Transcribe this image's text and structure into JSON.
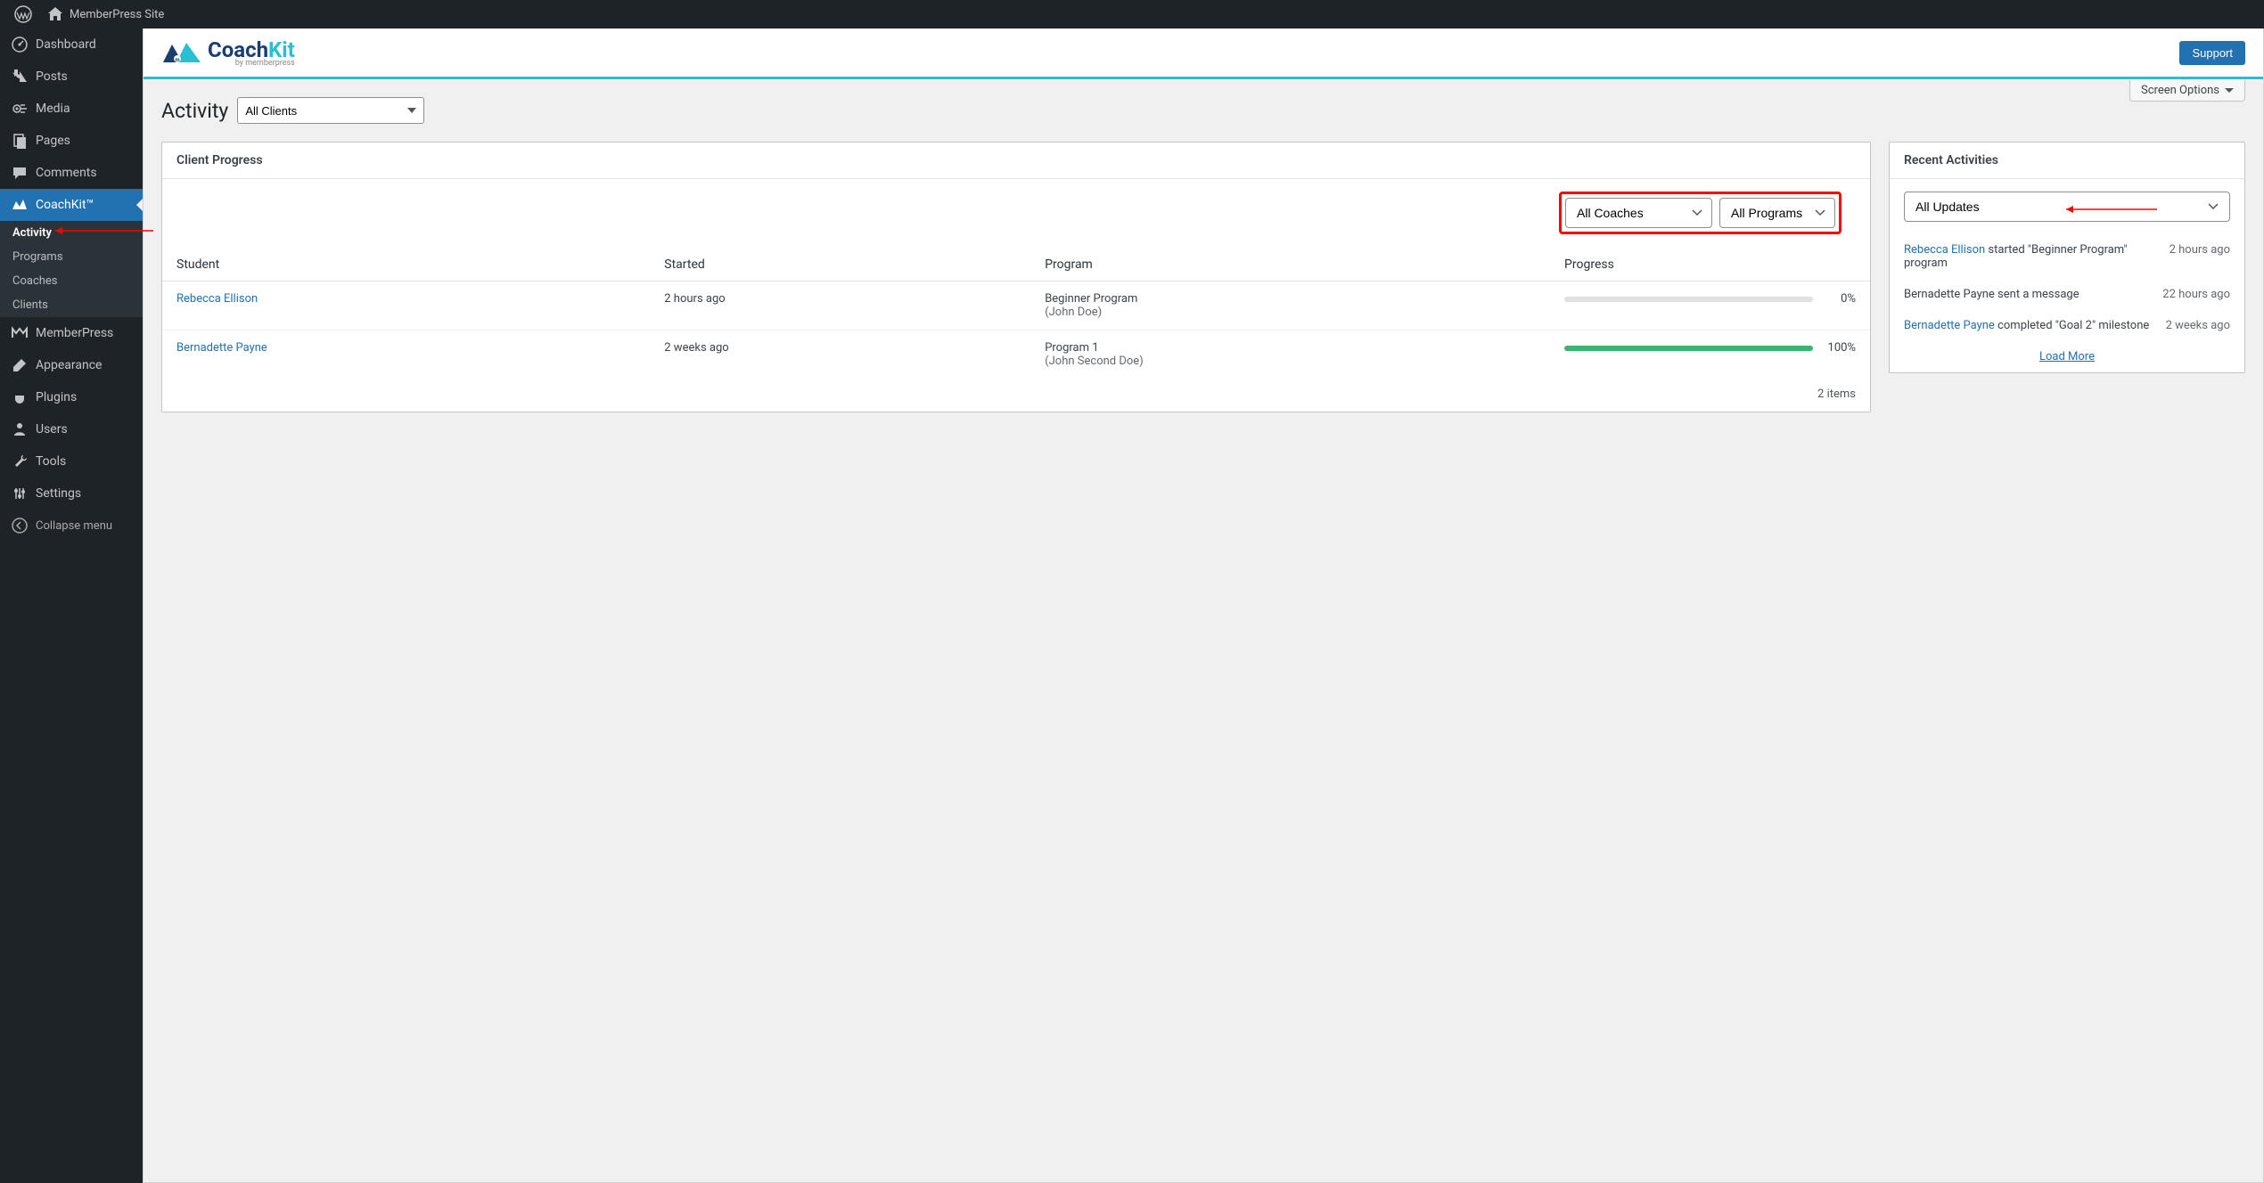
{
  "adminBar": {
    "siteName": "MemberPress Site"
  },
  "sidebar": {
    "items": [
      {
        "label": "Dashboard",
        "icon": "dashboard"
      },
      {
        "label": "Posts",
        "icon": "pin"
      },
      {
        "label": "Media",
        "icon": "media"
      },
      {
        "label": "Pages",
        "icon": "pages"
      },
      {
        "label": "Comments",
        "icon": "comments"
      },
      {
        "label": "CoachKit™",
        "icon": "coachkit",
        "active": true
      },
      {
        "label": "MemberPress",
        "icon": "memberpress"
      },
      {
        "label": "Appearance",
        "icon": "brush"
      },
      {
        "label": "Plugins",
        "icon": "plugin"
      },
      {
        "label": "Users",
        "icon": "user"
      },
      {
        "label": "Tools",
        "icon": "wrench"
      },
      {
        "label": "Settings",
        "icon": "settings"
      }
    ],
    "submenu": [
      {
        "label": "Activity",
        "current": true
      },
      {
        "label": "Programs"
      },
      {
        "label": "Coaches"
      },
      {
        "label": "Clients"
      }
    ],
    "collapse": "Collapse menu"
  },
  "banner": {
    "logoPart1": "Coach",
    "logoPart2": "Kit",
    "logoSub": "by memberpress",
    "support": "Support"
  },
  "screenOptions": "Screen Options",
  "page": {
    "title": "Activity",
    "clientsFilter": "All Clients"
  },
  "clientProgress": {
    "title": "Client Progress",
    "coachFilter": "All Coaches",
    "programFilter": "All Programs",
    "columns": {
      "student": "Student",
      "started": "Started",
      "program": "Program",
      "progress": "Progress"
    },
    "rows": [
      {
        "student": "Rebecca Ellison",
        "started": "2 hours ago",
        "program": "Beginner Program",
        "coach": "(John Doe)",
        "progress": 0,
        "progressLabel": "0%"
      },
      {
        "student": "Bernadette Payne",
        "started": "2 weeks ago",
        "program": "Program 1",
        "coach": "(John Second Doe)",
        "progress": 100,
        "progressLabel": "100%"
      }
    ],
    "itemsCount": "2 items"
  },
  "recentActivities": {
    "title": "Recent Activities",
    "filter": "All Updates",
    "items": [
      {
        "link": "Rebecca Ellison",
        "textAfter": " started \"Beginner Program\" program",
        "time": "2 hours ago"
      },
      {
        "textBefore": "Bernadette Payne sent a message",
        "time": "22 hours ago"
      },
      {
        "link": "Bernadette Payne",
        "textAfter": " completed \"Goal 2\" milestone",
        "time": "2 weeks ago"
      }
    ],
    "loadMore": "Load More"
  }
}
